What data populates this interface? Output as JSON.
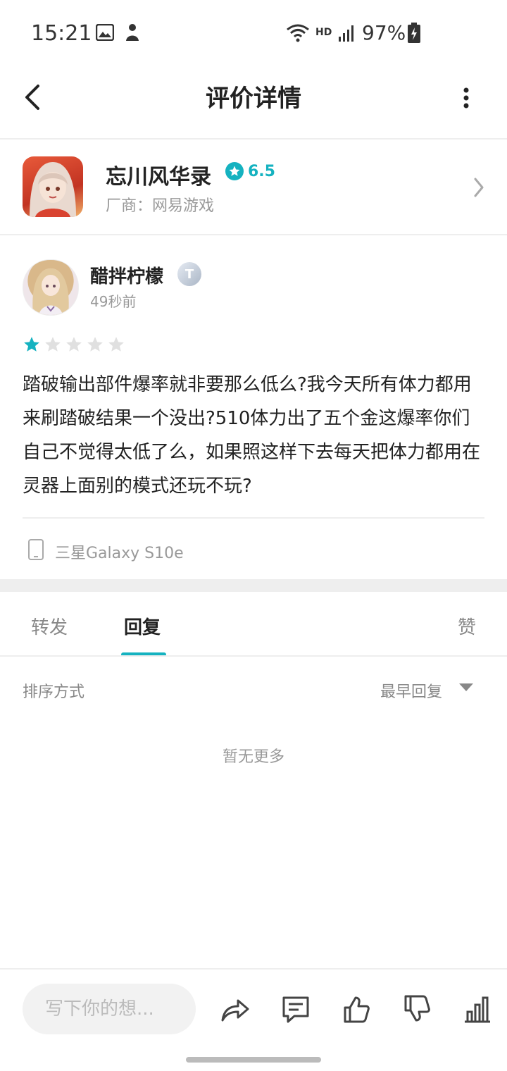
{
  "status_bar": {
    "time": "15:21",
    "network": "HD",
    "battery": "97%"
  },
  "header": {
    "title": "评价详情",
    "back_icon": "back-arrow-icon",
    "menu_icon": "more-vertical-icon"
  },
  "game": {
    "name": "忘川风华录",
    "score": "6.5",
    "vendor": "厂商：网易游戏"
  },
  "review": {
    "user_name": "醋拌柠檬",
    "badge": "T",
    "time_ago": "49秒前",
    "rating": 1,
    "rating_max": 5,
    "text": "踏破输出部件爆率就非要那么低么?我今天所有体力都用来刷踏破结果一个没出?510体力出了五个金这爆率你们自己不觉得太低了么，如果照这样下去每天把体力都用在灵器上面别的模式还玩不玩?",
    "device": "三星Galaxy S10e"
  },
  "tabs": {
    "forward": "转发",
    "reply": "回复",
    "like": "赞",
    "active": "reply"
  },
  "sort": {
    "label": "排序方式",
    "value": "最早回复"
  },
  "empty": "暂无更多",
  "bottom_bar": {
    "input_placeholder": "写下你的想..."
  },
  "colors": {
    "accent": "#15b2c0",
    "star_inactive": "#e0e0e0"
  }
}
